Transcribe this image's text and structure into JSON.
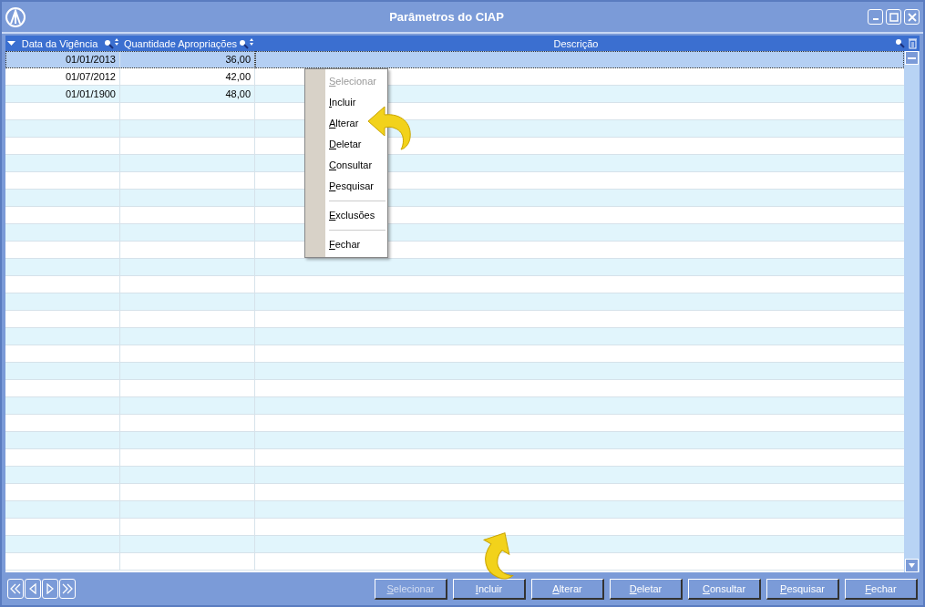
{
  "window": {
    "title": "Parâmetros do CIAP"
  },
  "table": {
    "columns": [
      {
        "label": "Data da Vigência",
        "searchable": true
      },
      {
        "label": "Quantidade Apropriações",
        "searchable": true
      },
      {
        "label": "Descrição",
        "searchable": false
      }
    ],
    "rows": [
      {
        "cells": [
          "01/01/2013",
          "36,00"
        ],
        "selected": true
      },
      {
        "cells": [
          "01/07/2012",
          "42,00"
        ],
        "selected": false
      },
      {
        "cells": [
          "01/01/1900",
          "48,00"
        ],
        "selected": false
      }
    ]
  },
  "context_menu": {
    "items": [
      {
        "label": "Selecionar",
        "disabled": true,
        "separator_before": false
      },
      {
        "label": "Incluir",
        "disabled": false,
        "separator_before": false
      },
      {
        "label": "Alterar",
        "disabled": false,
        "separator_before": false
      },
      {
        "label": "Deletar",
        "disabled": false,
        "separator_before": false
      },
      {
        "label": "Consultar",
        "disabled": false,
        "separator_before": false
      },
      {
        "label": "Pesquisar",
        "disabled": false,
        "separator_before": false
      },
      {
        "label": "Exclusões",
        "disabled": false,
        "separator_before": true
      },
      {
        "label": "Fechar",
        "disabled": false,
        "separator_before": true
      }
    ]
  },
  "buttons": [
    {
      "label": "Selecionar",
      "disabled": true
    },
    {
      "label": "Incluir",
      "disabled": false
    },
    {
      "label": "Alterar",
      "disabled": false
    },
    {
      "label": "Deletar",
      "disabled": false
    },
    {
      "label": "Consultar",
      "disabled": false
    },
    {
      "label": "Pesquisar",
      "disabled": false
    },
    {
      "label": "Fechar",
      "disabled": false
    }
  ]
}
